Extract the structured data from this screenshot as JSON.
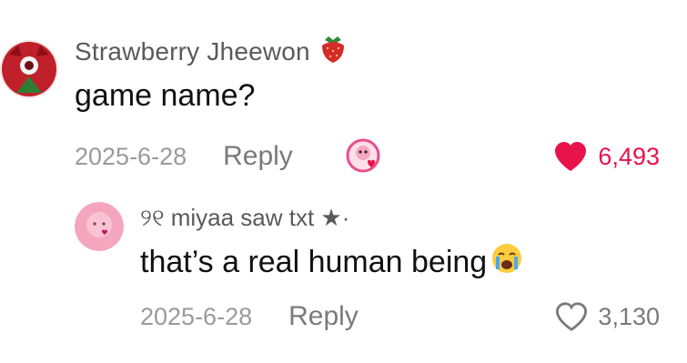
{
  "comment": {
    "author": "Strawberry Jheewon",
    "author_badge_icon": "strawberry-icon",
    "text": "game name?",
    "date": "2025-6-28",
    "reply_label": "Reply",
    "gift_icon": "gift-sticker-icon",
    "likes": "6,493",
    "liked": true,
    "like_color": "#e8134a"
  },
  "reply": {
    "author": "୨୧ miyaa saw txt ★·",
    "text": "that’s a real human being",
    "text_emoji_icon": "crying-face-icon",
    "date": "2025-6-28",
    "reply_label": "Reply",
    "likes": "3,130",
    "liked": false
  }
}
